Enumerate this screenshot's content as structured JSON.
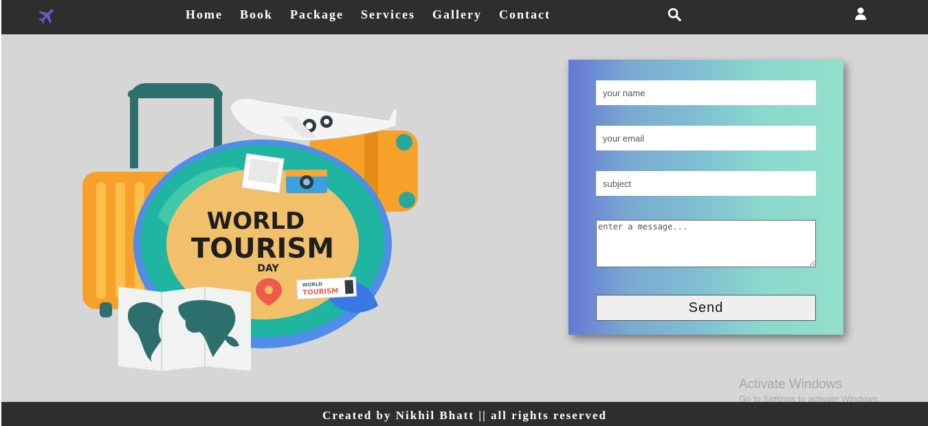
{
  "header": {
    "logo_icon": "airplane-icon",
    "nav": [
      {
        "label": "Home"
      },
      {
        "label": "Book"
      },
      {
        "label": "Package"
      },
      {
        "label": "Services"
      },
      {
        "label": "Gallery"
      },
      {
        "label": "Contact"
      }
    ],
    "search_icon": "search-icon",
    "user_icon": "user-icon"
  },
  "hero": {
    "badge_line1": "WORLD",
    "badge_line2": "TOURISM",
    "badge_line3": "DAY",
    "ticket_line1": "WORLD",
    "ticket_line2": "TOURISM"
  },
  "form": {
    "name_placeholder": "your name",
    "email_placeholder": "your email",
    "subject_placeholder": "subject",
    "message_placeholder": "enter a message...",
    "send_label": "Send"
  },
  "watermark": {
    "title": "Activate Windows",
    "subtitle": "Go to Settings to activate Windows."
  },
  "footer": {
    "text": "Created by Nikhil Bhatt || all rights reserved"
  },
  "colors": {
    "header_bg": "#2e2e2e",
    "page_bg": "#d6d6d6",
    "logo": "#5b5fc7",
    "gradient_start": "#6578d4",
    "gradient_end": "#92dfcc"
  }
}
